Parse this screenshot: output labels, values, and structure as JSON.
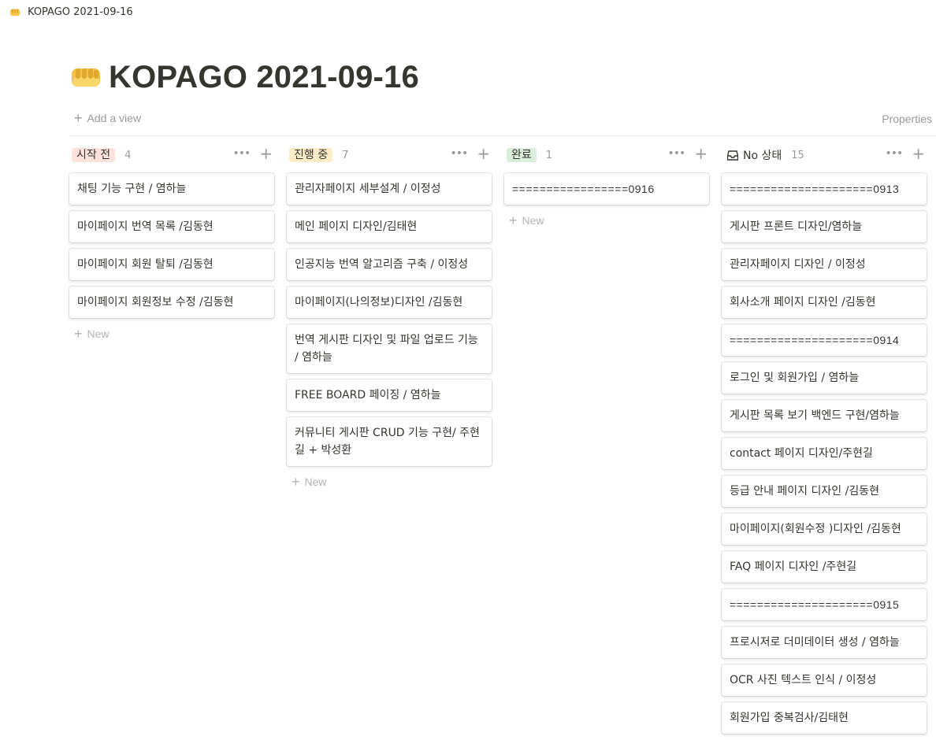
{
  "window": {
    "tab_title": "KOPAGO 2021-09-16",
    "page_icon": "fist-emoji-icon"
  },
  "page": {
    "title": "KOPAGO 2021-09-16"
  },
  "viewbar": {
    "add_view_label": "Add a view",
    "properties_label": "Properties"
  },
  "new_label": "New",
  "colors": {
    "text": "#37352f",
    "muted": "#9b9a97",
    "tag_red": "#ffe2dd",
    "tag_yellow": "#fdecc8",
    "tag_green": "#dbeddb"
  },
  "columns": [
    {
      "label": "시작 전",
      "count": "4",
      "cards": [
        "채팅 기능 구현 / 염하늘",
        "마이페이지 번역 목록 /김동현",
        "마이페이지 회원 탈퇴 /김동현",
        "마이페이지 회원정보 수정 /김동현"
      ]
    },
    {
      "label": "진행 중",
      "count": "7",
      "cards": [
        "관리자페이지 세부설계 / 이정성",
        "메인 페이지 디자인/김태현",
        "인공지능 번역 알고리즘 구축 / 이정성",
        "마이페이지(나의정보)디자인 /김동현",
        "번역 게시판 디자인 및 파일 업로드 기능 / 염하늘",
        "FREE BOARD 페이징 / 염하늘",
        "커뮤니티 게시판 CRUD 기능 구현/ 주현길 + 박성환"
      ]
    },
    {
      "label": "완료",
      "count": "1",
      "cards": [
        "=================0916"
      ]
    },
    {
      "label": "No 상태",
      "count": "15",
      "cards": [
        "=====================0913",
        "게시판 프론트 디자인/염하늘",
        "관리자페이지 디자인 / 이정성",
        "회사소개 페이지 디자인 /김동현",
        "=====================0914",
        "로그인 및 회원가입 / 염하늘",
        "게시판 목록 보기 백엔드 구현/염하늘",
        "contact 페이지 디자인/주현길",
        "등급 안내 페이지 디자인 /김동현",
        "마이페이지(회원수정 )디자인 /김동현",
        "FAQ 페이지 디자인 /주현길",
        "=====================0915",
        "프로시저로 더미데이터 생성 / 염하늘",
        "OCR 사진 텍스트 인식 / 이정성",
        "회원가입 중복검사/김태현"
      ]
    }
  ]
}
